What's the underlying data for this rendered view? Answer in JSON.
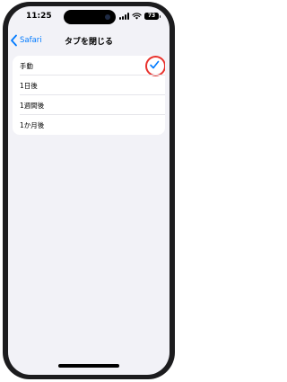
{
  "status_bar": {
    "time": "11:25",
    "battery_level": "73"
  },
  "nav": {
    "back_label": "Safari",
    "title": "タブを閉じる"
  },
  "options": [
    {
      "label": "手動",
      "selected": true
    },
    {
      "label": "1日後",
      "selected": false
    },
    {
      "label": "1週間後",
      "selected": false
    },
    {
      "label": "1か月後",
      "selected": false
    }
  ],
  "colors": {
    "accent": "#007aff",
    "highlight": "#e8322d",
    "background": "#f2f2f7"
  }
}
